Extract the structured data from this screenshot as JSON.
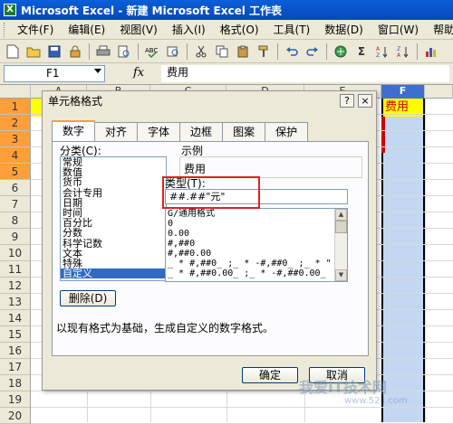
{
  "window": {
    "title": "Microsoft Excel - 新建 Microsoft Excel 工作表"
  },
  "menu": [
    "文件(F)",
    "编辑(E)",
    "视图(V)",
    "插入(I)",
    "格式(O)",
    "工具(T)",
    "数据(D)",
    "窗口(W)",
    "帮助(H)"
  ],
  "toolbar": {
    "icons": [
      "new-icon",
      "open-icon",
      "save-icon",
      "permission-icon",
      "print-icon",
      "print-preview-icon",
      "spelling-icon",
      "research-icon",
      "cut-icon",
      "copy-icon",
      "paste-icon",
      "format-painter-icon",
      "undo-icon",
      "redo-icon",
      "hyperlink-icon",
      "autosum-icon",
      "sort-ascending-icon",
      "sort-descending-icon",
      "chart-wizard-icon"
    ],
    "autosum_label": "Σ"
  },
  "formula_bar": {
    "name_box": "F1",
    "fx_label": "fx",
    "content": "费用"
  },
  "sheet": {
    "columns": [
      "A",
      "B",
      "C",
      "D",
      "E",
      "F"
    ],
    "rows": [
      "1",
      "2",
      "3",
      "4",
      "5",
      "6",
      "7",
      "8",
      "9",
      "10",
      "11",
      "12",
      "13",
      "14",
      "15",
      "16",
      "17",
      "18",
      "19",
      "20"
    ],
    "highlighted_rows": [
      "1",
      "2",
      "3",
      "4",
      "5"
    ],
    "selected_column": "F",
    "cell_F1": "费用"
  },
  "dialog": {
    "title": "单元格格式",
    "help_label": "?",
    "close_label": "×",
    "tabs": [
      "数字",
      "对齐",
      "字体",
      "边框",
      "图案",
      "保护"
    ],
    "active_tab": "数字",
    "category_label": "分类(C):",
    "categories": [
      "常规",
      "数值",
      "货币",
      "会计专用",
      "日期",
      "时间",
      "百分比",
      "分数",
      "科学记数",
      "文本",
      "特殊",
      "自定义"
    ],
    "selected_category": "自定义",
    "sample_label": "示例",
    "sample_value": "费用",
    "type_label": "类型(T):",
    "type_value": "##.##\"元\"",
    "formats": [
      "G/通用格式",
      "0",
      "0.00",
      "#,##0",
      "#,##0.00",
      "_ * #,##0_ ;_ * -#,##0_ ;_ * \"",
      "_ * #,##0.00_ ;_ * -#,##0.00_"
    ],
    "delete_button": "删除(D)",
    "description": "以现有格式为基础，生成自定义的数字格式。",
    "ok_button": "确定",
    "cancel_button": "取消"
  },
  "watermark": {
    "text": "我爱IT技术网",
    "sub": "www.52ij.com"
  },
  "colors": {
    "title_bar": "#0a5fd8",
    "row_highlight": "#ff9f3a",
    "cell_yellow": "#ffff00",
    "cell_text_red": "#d00000",
    "selection": "#c4d7f2",
    "annotation_red": "#e02020"
  }
}
